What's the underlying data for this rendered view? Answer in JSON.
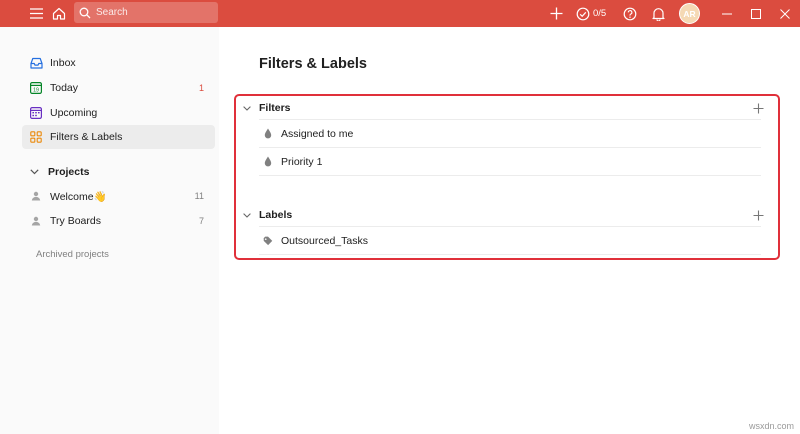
{
  "topbar": {
    "search_placeholder": "Search",
    "karma": "0/5",
    "avatar_initials": "AR"
  },
  "sidebar": {
    "items": [
      {
        "label": "Inbox",
        "count": ""
      },
      {
        "label": "Today",
        "count": "1"
      },
      {
        "label": "Upcoming",
        "count": ""
      },
      {
        "label": "Filters & Labels",
        "count": ""
      }
    ],
    "projects_header": "Projects",
    "projects": [
      {
        "label": "Welcome",
        "emoji": "👋",
        "count": "11"
      },
      {
        "label": "Try Boards",
        "count": "7"
      }
    ],
    "archived": "Archived projects"
  },
  "main": {
    "title": "Filters & Labels",
    "filters_header": "Filters",
    "filters": [
      {
        "label": "Assigned to me"
      },
      {
        "label": "Priority 1"
      }
    ],
    "labels_header": "Labels",
    "labels": [
      {
        "label": "Outsourced_Tasks"
      }
    ]
  },
  "colors": {
    "accent": "#db4c3f",
    "highlight": "#e0303a",
    "inbox": "#246fe0",
    "today": "#058527",
    "upcoming": "#692fc2",
    "filters": "#eb8909"
  },
  "icons": {
    "menu": "hamburger-icon",
    "home": "home-icon",
    "search": "search-icon",
    "add": "plus-icon",
    "productivity": "productivity-icon",
    "help": "help-icon",
    "notifications": "bell-icon",
    "filter": "drop-icon",
    "label": "tag-icon"
  },
  "watermark": "wsxdn.com"
}
